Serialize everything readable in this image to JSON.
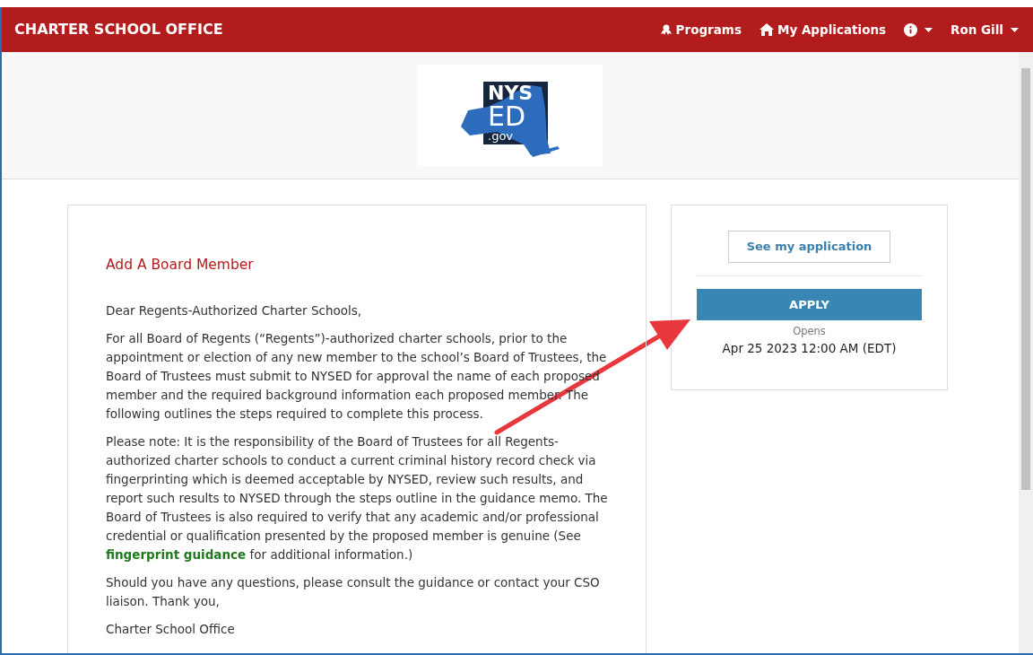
{
  "navbar": {
    "brand": "CHARTER SCHOOL OFFICE",
    "items": [
      {
        "kind": "programs",
        "label": "Programs"
      },
      {
        "kind": "home",
        "label": "My Applications"
      },
      {
        "kind": "info",
        "dropdown": true
      },
      {
        "kind": "user",
        "label": "Ron Gill",
        "dropdown": true
      }
    ]
  },
  "logo": {
    "line1": "NYS",
    "line2": "ED",
    "line3": ".gov"
  },
  "content": {
    "title": "Add A Board Member",
    "greeting": "Dear Regents-Authorized Charter Schools,",
    "paragraphs": [
      {
        "text": "For all Board of Regents (“Regents”)-authorized charter schools, prior to the appointment or election of any new member to the school’s Board of Trustees, the Board of Trustees must submit to NYSED for approval the name of each proposed member and the required background information each proposed member.  The following outlines the steps required to complete this process."
      },
      {
        "text": "Please note: It is the responsibility of the Board of Trustees for all Regents-authorized charter schools to conduct a current criminal history record check via fingerprinting which is deemed acceptable by NYSED, review such results, and report such results to NYSED through the steps outline in the guidance memo.  The Board of Trustees is also required to verify that any academic and/or professional credential or qualification presented by the proposed member is genuine (See ",
        "link": "fingerprint guidance",
        "after": " for additional information.)"
      },
      {
        "text": "Should you have any questions, please consult the guidance or contact your CSO liaison.  Thank you,"
      }
    ],
    "signature": "Charter School Office"
  },
  "sidebar": {
    "secondary_button": "See my application",
    "primary_button": "APPLY",
    "opens_label": "Opens",
    "opens_date": "Apr 25 2023 12:00 AM (EDT)"
  }
}
